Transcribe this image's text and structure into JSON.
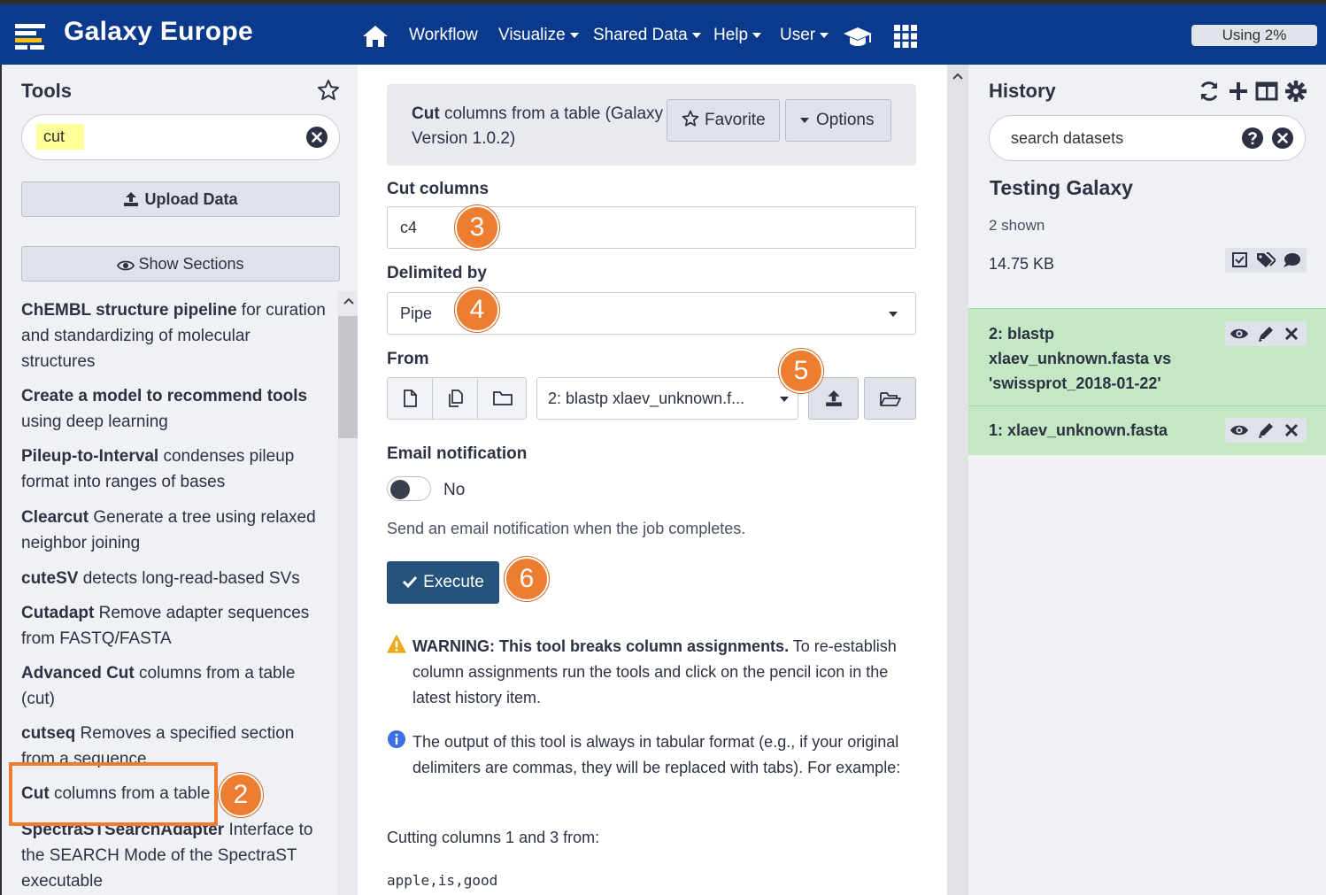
{
  "navbar": {
    "brand": "Galaxy Europe",
    "items": [
      {
        "label": "Workflow",
        "caret": false
      },
      {
        "label": "Visualize",
        "caret": true
      },
      {
        "label": "Shared Data",
        "caret": true
      },
      {
        "label": "Help",
        "caret": true
      },
      {
        "label": "User",
        "caret": true
      }
    ],
    "quota": "Using 2%"
  },
  "tools": {
    "title": "Tools",
    "search_value": "cut",
    "upload_label": "Upload Data",
    "sections_label": "Show Sections",
    "items": [
      {
        "name": "ChEMBL structure pipeline",
        "desc": "for curation and standardizing of molecular structures"
      },
      {
        "name": "Create a model to recommend tools",
        "desc": "using deep learning"
      },
      {
        "name": "Pileup-to-Interval",
        "desc": "condenses pileup format into ranges of bases"
      },
      {
        "name": "Clearcut",
        "desc": "Generate a tree using relaxed neighbor joining"
      },
      {
        "name": "cuteSV",
        "desc": "detects long-read-based SVs"
      },
      {
        "name": "Cutadapt",
        "desc": "Remove adapter sequences from FASTQ/FASTA"
      },
      {
        "name": "Advanced Cut",
        "desc": "columns from a table (cut)"
      },
      {
        "name": "cutseq",
        "desc": "Removes a specified section from a sequence"
      },
      {
        "name": "Cut",
        "desc": "columns from a table"
      },
      {
        "name": "SpectraSTSearchAdapter",
        "desc": "Interface to the SEARCH Mode of the SpectraST executable"
      }
    ]
  },
  "form": {
    "tool_name": "Cut",
    "tool_desc": "columns from a table (Galaxy Version 1.0.2)",
    "favorite_label": "Favorite",
    "options_label": "Options",
    "cut_columns_label": "Cut columns",
    "cut_columns_value": "c4",
    "delimited_label": "Delimited by",
    "delimited_value": "Pipe",
    "from_label": "From",
    "from_value": "2: blastp xlaev_unknown.f...",
    "email_label": "Email notification",
    "email_toggle": "No",
    "email_help": "Send an email notification when the job completes.",
    "execute_label": "Execute",
    "warning_bold": "WARNING: This tool breaks column assignments.",
    "warning_text": "To re-establish column assignments run the tools and click on the pencil icon in the latest history item.",
    "info_text": "The output of this tool is always in tabular format (e.g., if your original delimiters are commas, they will be replaced with tabs). For example:",
    "example_lead": "Cutting columns 1 and 3 from:",
    "example_code": "apple,is,good"
  },
  "history": {
    "title": "History",
    "search_placeholder": "search datasets",
    "name": "Testing Galaxy",
    "shown": "2 shown",
    "size": "14.75 KB",
    "datasets": [
      {
        "title": "2: blastp xlaev_unknown.fasta vs 'swissprot_2018-01-22'"
      },
      {
        "title": "1: xlaev_unknown.fasta"
      }
    ]
  },
  "annotations": [
    "2",
    "3",
    "4",
    "5",
    "6"
  ],
  "colors": {
    "navbar": "#0b3a8c",
    "accent": "#ed7d31",
    "execute": "#25537b",
    "dataset_ok": "#c4e8c3"
  }
}
